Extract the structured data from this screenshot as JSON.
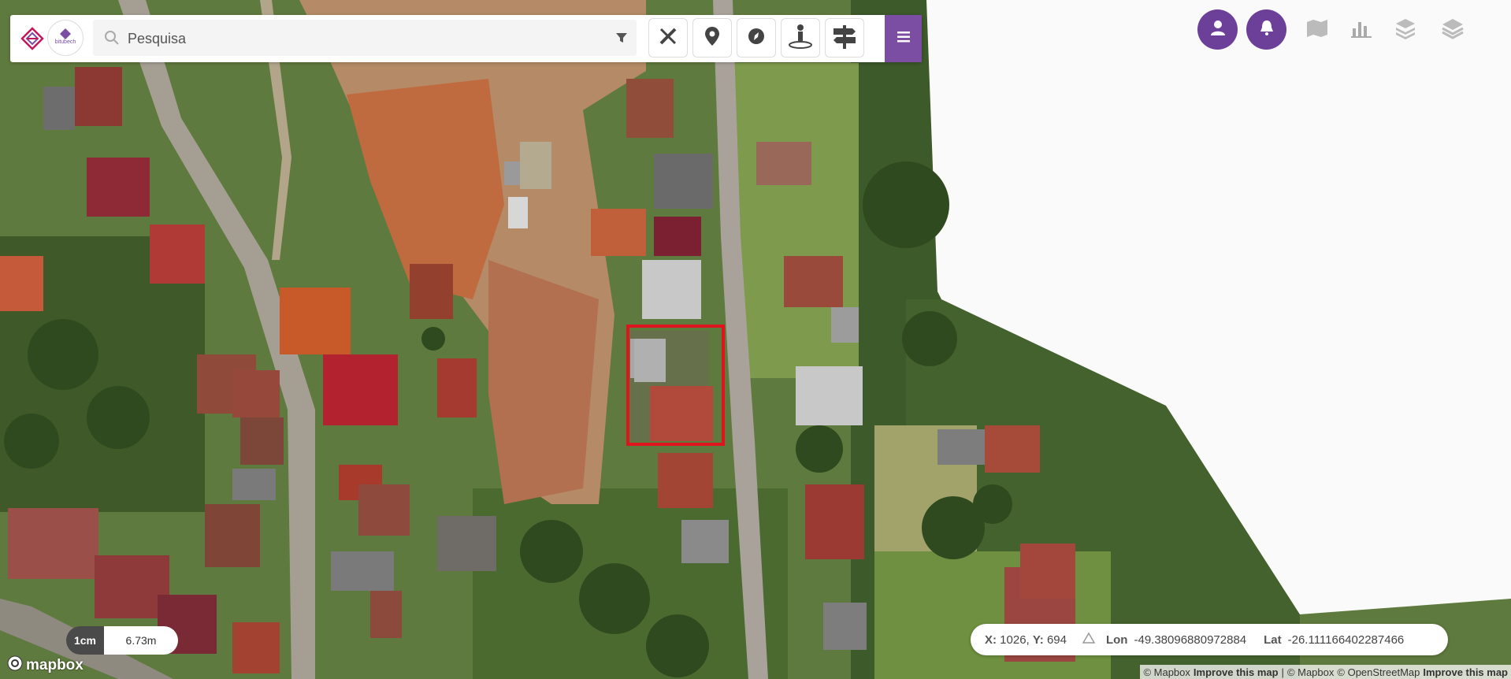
{
  "search": {
    "placeholder": "Pesquisa"
  },
  "logo": {
    "brand": "bitubech"
  },
  "toolbar": {
    "tools": [
      {
        "name": "measure-tool-button",
        "icon": "ruler-pencil-icon"
      },
      {
        "name": "marker-tool-button",
        "icon": "map-pin-icon"
      },
      {
        "name": "compass-tool-button",
        "icon": "compass-icon"
      },
      {
        "name": "street-view-button",
        "icon": "person-pin-icon"
      },
      {
        "name": "signpost-button",
        "icon": "signpost-icon"
      }
    ],
    "menu_icon": "hamburger-menu-icon"
  },
  "top_right": {
    "user_icon": "user-icon",
    "notification_icon": "bell-icon",
    "map_icon": "map-icon",
    "chart_icon": "bar-chart-icon",
    "layers_3d_icon": "stacked-layers-icon",
    "layers_icon": "layers-icon"
  },
  "scale": {
    "unit": "1cm",
    "distance": "6.73m"
  },
  "branding": {
    "mapbox": "mapbox"
  },
  "coordinates": {
    "x_label": "X:",
    "x_value": "1026,",
    "y_label": "Y:",
    "y_value": "694",
    "lon_label": "Lon",
    "lon_value": "-49.38096880972884",
    "lat_label": "Lat",
    "lat_value": "-26.111166402287466"
  },
  "attribution": {
    "mapbox_1": "© Mapbox",
    "improve_1": "Improve this map",
    "sep": "|",
    "mapbox_2": "© Mapbox",
    "osm": "© OpenStreetMap",
    "improve_2": "Improve this map"
  },
  "colors": {
    "accent": "#7b4ea3",
    "highlight": "#e0141e"
  }
}
